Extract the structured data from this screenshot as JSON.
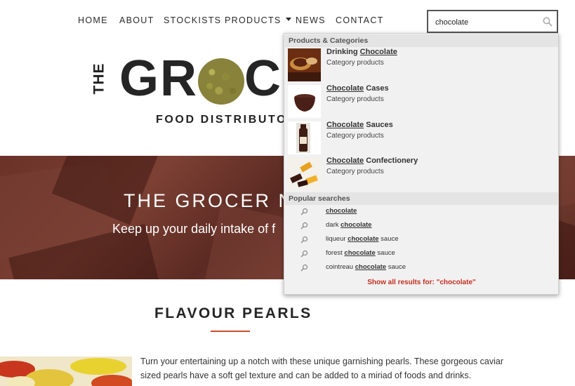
{
  "nav": {
    "items": [
      {
        "label": "HOME"
      },
      {
        "label": "ABOUT"
      },
      {
        "label": "STOCKISTS"
      },
      {
        "label": "PRODUCTS"
      },
      {
        "label": "NEWS"
      },
      {
        "label": "CONTACT"
      }
    ]
  },
  "search": {
    "value": "chocolate"
  },
  "logo": {
    "the": "THE",
    "main_left": "GR",
    "main_right": "C",
    "subtitle": "FOOD DISTRIBUTO"
  },
  "hero": {
    "title": "THE GROCER N",
    "subtitle": "Keep up your daily intake of f"
  },
  "section": {
    "title": "FLAVOUR PEARLS",
    "body": "Turn your entertaining up a notch with these unique garnishing pearls. These gorgeous caviar sized pearls have a soft gel texture and can be added to a miriad of foods and drinks."
  },
  "dropdown": {
    "products_header": "Products & Categories",
    "products": [
      {
        "pre": "Drinking ",
        "match": "Chocolate",
        "post": "",
        "category": "Category products"
      },
      {
        "pre": "",
        "match": "Chocolate",
        "post": " Cases",
        "category": "Category products"
      },
      {
        "pre": "",
        "match": "Chocolate",
        "post": " Sauces",
        "category": "Category products"
      },
      {
        "pre": "",
        "match": "Chocolate",
        "post": " Confectionery",
        "category": "Category products"
      }
    ],
    "popular_header": "Popular searches",
    "popular": [
      {
        "pre": "",
        "match": "chocolate",
        "post": ""
      },
      {
        "pre": "dark ",
        "match": "chocolate",
        "post": ""
      },
      {
        "pre": "liqueur ",
        "match": "chocolate",
        "post": " sauce"
      },
      {
        "pre": "forest ",
        "match": "chocolate",
        "post": " sauce"
      },
      {
        "pre": "cointreau ",
        "match": "chocolate",
        "post": " sauce"
      }
    ],
    "show_all": "Show all results for: \"chocolate\""
  },
  "colors": {
    "accent_red": "#c62d1f",
    "rule_orange": "#d24a2c",
    "hero_brown": "#6a3228"
  }
}
